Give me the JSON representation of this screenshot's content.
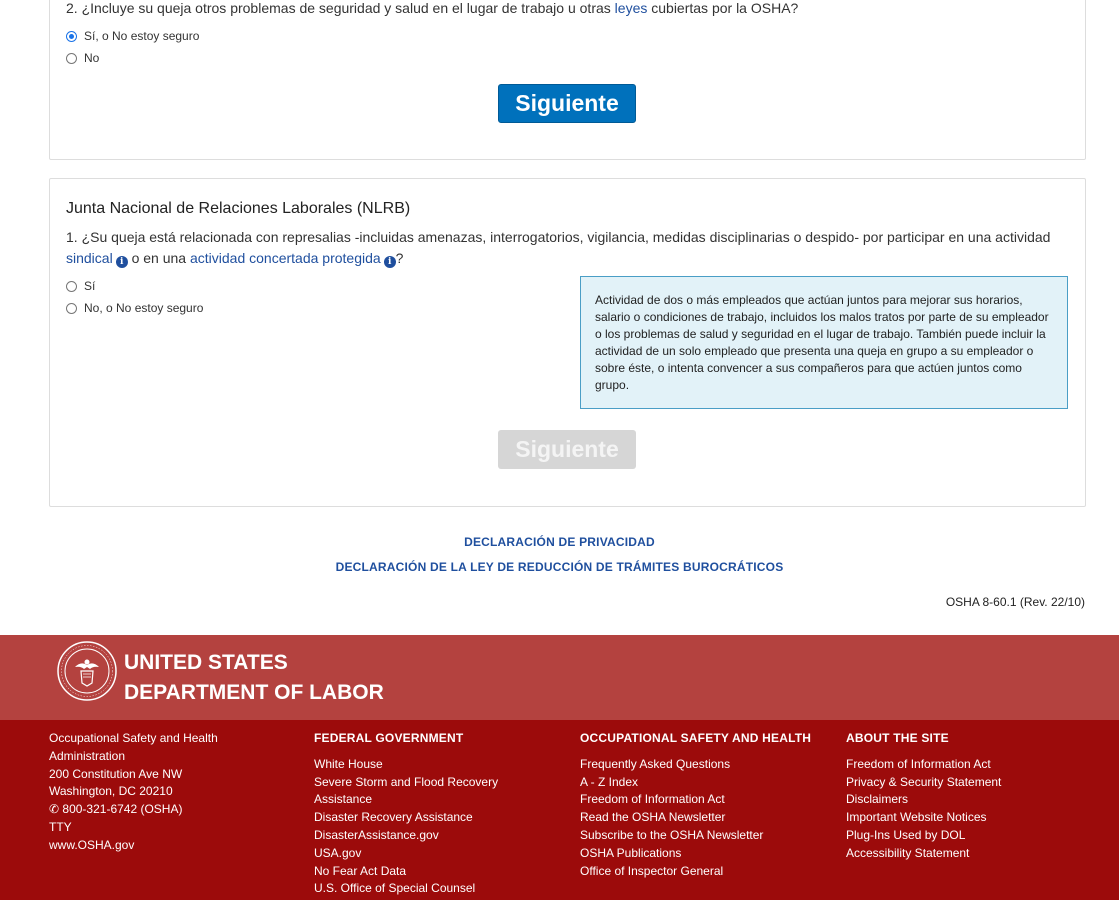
{
  "card1": {
    "question_prefix": "2. ¿Incluye su queja otros problemas de seguridad y salud en el lugar de trabajo u otras",
    "question_link": "leyes",
    "question_suffix": "cubiertas por la OSHA?",
    "options": [
      "Sí, o No estoy seguro",
      "No"
    ],
    "selected_index": 0,
    "button_label": "Siguiente"
  },
  "card2": {
    "title": "Junta Nacional de Relaciones Laborales (NLRB)",
    "question_prefix": "1. ¿Su queja está relacionada con represalias -incluidas amenazas, interrogatorios, vigilancia, medidas disciplinarias o despido- por participar en una actividad",
    "link1": "sindical",
    "middle": "o en una",
    "link2": "actividad concertada protegida",
    "question_end": "?",
    "options": [
      "Sí",
      "No, o No estoy seguro"
    ],
    "tooltip": "Actividad de dos o más empleados que actúan juntos para mejorar sus horarios, salario o condiciones de trabajo, incluidos los malos tratos por parte de su empleador o los problemas de salud y seguridad en el lugar de trabajo. También puede incluir la actividad de un solo empleado que presenta una queja en grupo a su empleador o sobre éste, o intenta convencer a sus compañeros para que actúen juntos como grupo.",
    "button_label": "Siguiente"
  },
  "links": {
    "privacy": "DECLARACIÓN DE PRIVACIDAD",
    "paperwork": "DECLARACIÓN DE LA LEY DE REDUCCIÓN DE TRÁMITES BUROCRÁTICOS"
  },
  "form_number": "OSHA 8-60.1 (Rev. 22/10)",
  "footer": {
    "org_line1": "UNITED STATES",
    "org_line2": "DEPARTMENT OF LABOR",
    "address": [
      "Occupational Safety and Health",
      "Administration",
      "200 Constitution Ave NW",
      "Washington, DC 20210"
    ],
    "phone": "800-321-6742 (OSHA)",
    "tty": "TTY",
    "website": "www.OSHA.gov",
    "columns": [
      {
        "heading": "FEDERAL GOVERNMENT",
        "items": [
          "White House",
          "Severe Storm and Flood Recovery",
          "Assistance",
          "Disaster Recovery Assistance",
          "DisasterAssistance.gov",
          "USA.gov",
          "No Fear Act Data",
          "U.S. Office of Special Counsel"
        ]
      },
      {
        "heading": "OCCUPATIONAL SAFETY AND HEALTH",
        "items": [
          "Frequently Asked Questions",
          "A - Z Index",
          "Freedom of Information Act",
          "Read the OSHA Newsletter",
          "Subscribe to the OSHA Newsletter",
          "OSHA Publications",
          "Office of Inspector General"
        ]
      },
      {
        "heading": "ABOUT THE SITE",
        "items": [
          "Freedom of Information Act",
          "Privacy & Security Statement",
          "Disclaimers",
          "Important Website Notices",
          "Plug-Ins Used by DOL",
          "Accessibility Statement"
        ]
      }
    ]
  },
  "colors": {
    "primary_button": "#0071bc",
    "link": "#1f4f9e",
    "footer_top": "#b4423f",
    "footer_main": "#9c0b0b",
    "tooltip_bg": "#e2f2f8"
  }
}
